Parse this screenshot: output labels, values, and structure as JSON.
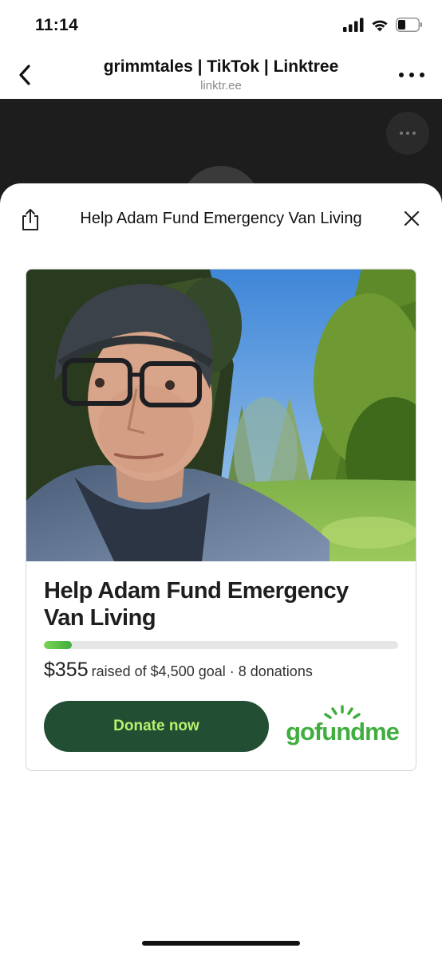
{
  "status_bar": {
    "time": "11:14",
    "icons": [
      "signal-icon",
      "wifi-icon",
      "battery-icon"
    ]
  },
  "browser": {
    "title": "grimmtales | TikTok | Linktree",
    "url": "linktr.ee"
  },
  "sheet": {
    "title": "Help Adam Fund Emergency Van Living"
  },
  "card": {
    "campaign_title": "Help Adam Fund Emergency Van Living",
    "raised": "$355",
    "goal_text": "raised of $4,500 goal · 8 donations",
    "progress_fraction": 0.079,
    "donate_label": "Donate now",
    "brand": "gofundme"
  },
  "colors": {
    "donate_bg": "#224f33",
    "donate_text": "#b9f06d",
    "brand_green": "#3fae3f",
    "dark_page": "#1d1d1d"
  }
}
